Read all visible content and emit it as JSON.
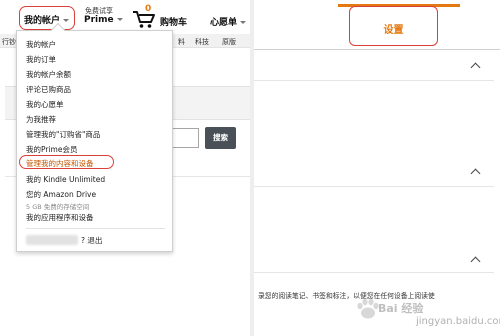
{
  "header": {
    "account_label": "我的帐户",
    "prime_top": "免费试享",
    "prime_label": "Prime",
    "cart_count": "0",
    "cart_label": "购物车",
    "wishlist_label": "心愿单"
  },
  "categories": [
    "行钞",
    "料",
    "科技",
    "原版"
  ],
  "search_button": "搜索",
  "dropdown": {
    "items": [
      "我的帐户",
      "我的订单",
      "我的帐户余额",
      "评论已购商品",
      "我的心愿单",
      "为我推荐",
      "管理我的\"订购省\"商品",
      "我的Prime会员",
      "管理我的内容和设备",
      "我的 Kindle Unlimited",
      "您的 Amazon Drive",
      "我的应用程序和设备"
    ],
    "drive_subtitle": "5 GB 免费的存储空间",
    "signout_label": "? 退出"
  },
  "settings": {
    "tab_label": "设置",
    "bottom_text": "录您的阅读笔记、书签和标注，以便您在任何设备上阅读使"
  },
  "watermark": {
    "text": "Bai 经验",
    "sub": "jingyan.baidu.com"
  },
  "colors": {
    "accent_orange": "#e47911",
    "highlight_red": "#d9403a",
    "search_button": "#4a5057"
  }
}
